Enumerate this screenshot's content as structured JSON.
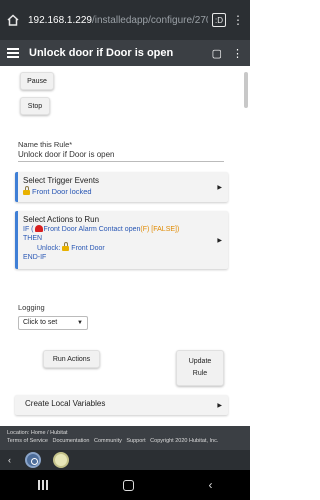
{
  "browser": {
    "url_host": "192.168.1.229",
    "url_path": "/installedapp/configure/2704",
    "tab_count": ":D"
  },
  "header": {
    "title": "Unlock door if Door is open"
  },
  "buttons": {
    "pause": "Pause",
    "stop": "Stop",
    "run_actions": "Run Actions",
    "update_rule": "Update Rule"
  },
  "rule_name": {
    "label": "Name this Rule*",
    "value": "Unlock door if Door is open"
  },
  "trigger": {
    "title": "Select Trigger Events",
    "item": "Front Door locked"
  },
  "actions": {
    "title": "Select Actions to Run",
    "if_prefix": "IF (",
    "condition": "Front Door Alarm Contact open",
    "cond_result": "(F)",
    "false_tag": "[FALSE])",
    "then": "THEN",
    "unlock_label": "Unlock:",
    "unlock_target": "Front Door",
    "end_if": "END-IF"
  },
  "logging": {
    "label": "Logging",
    "placeholder": "Click to set"
  },
  "local_vars": {
    "title": "Create Local Variables"
  },
  "footer": {
    "location": "Location: Home / Hubitat",
    "links": [
      "Terms of Service",
      "Documentation",
      "Community",
      "Support",
      "Copyright 2020 Hubitat, Inc."
    ]
  },
  "colors": {
    "accent_blue": "#3f7fd6",
    "header_bg": "#3b3f44",
    "status_orange": "#e08a00"
  }
}
